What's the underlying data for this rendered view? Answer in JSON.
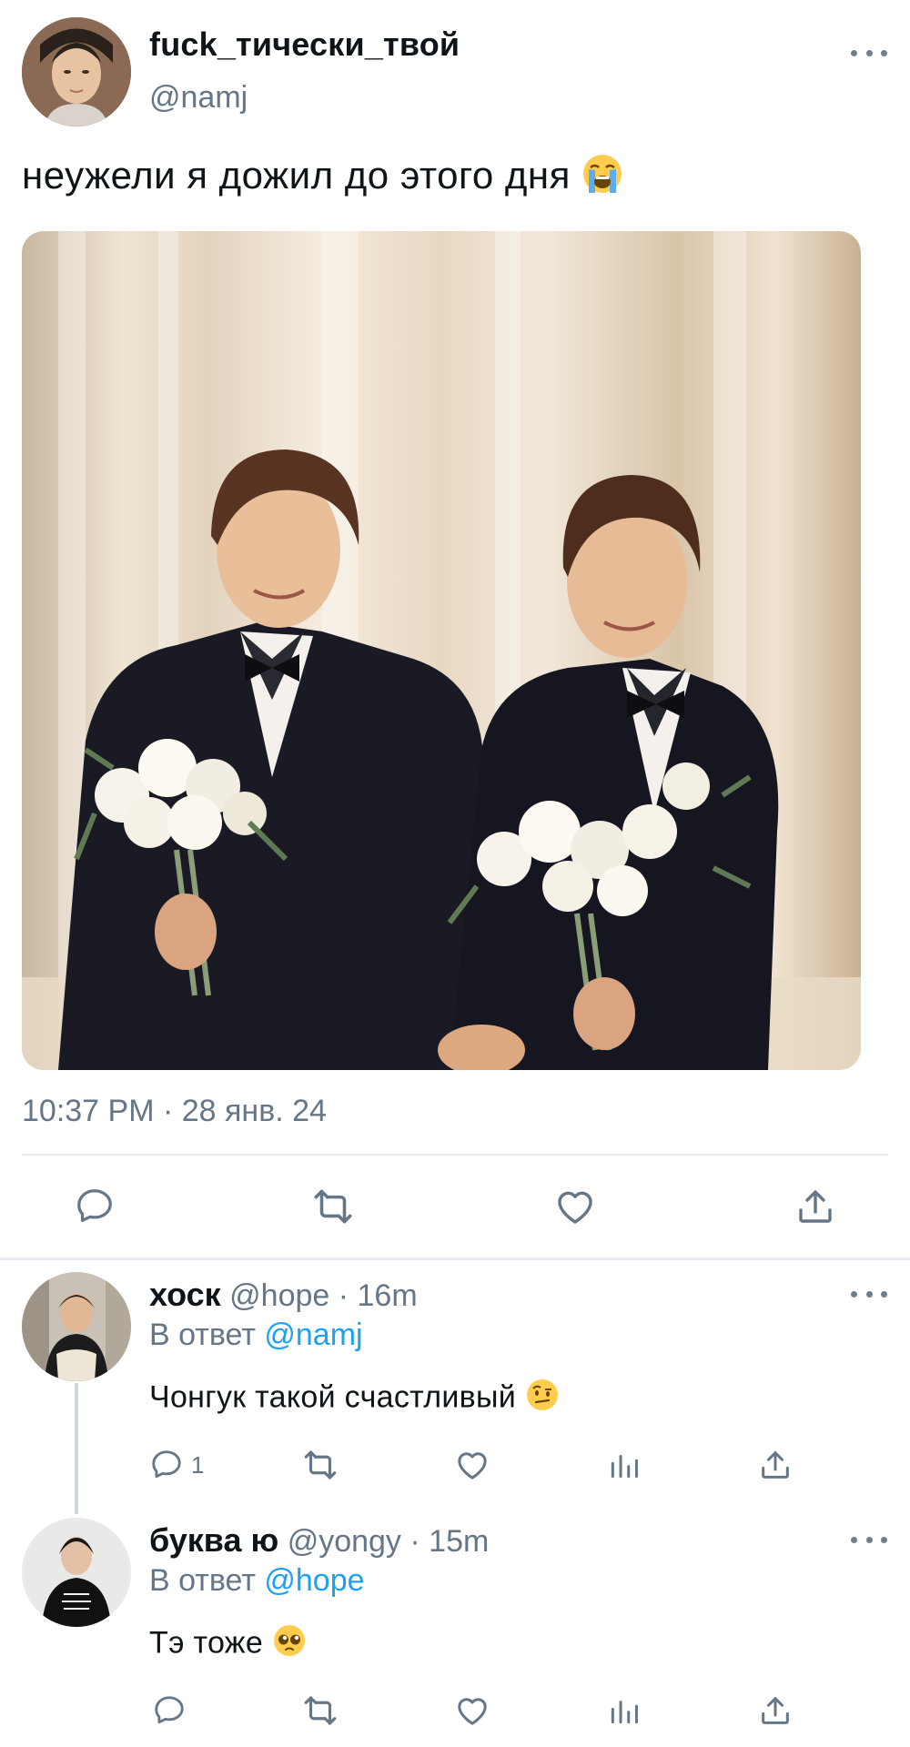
{
  "tweet": {
    "display_name": "fuck_тически_твой",
    "handle": "@namj",
    "text": "неужели я дожил до этого дня",
    "text_emoji": "loudly-crying-face",
    "timestamp": "10:37 PM · 28 янв. 24",
    "media_description_icon": "photo",
    "actions": {
      "reply_icon": "reply-icon",
      "retweet_icon": "retweet-icon",
      "like_icon": "heart-icon",
      "share_icon": "share-icon"
    }
  },
  "replies": [
    {
      "name": "хоск",
      "handle": "@hope",
      "time": "· 16m",
      "reply_to_label": "В ответ",
      "reply_to_mention": "@namj",
      "text": "Чонгук такой счастливый",
      "text_emoji": "face-with-raised-eyebrow",
      "reply_count": "1"
    },
    {
      "name": "буква ю",
      "handle": "@yongy",
      "time": "· 15m",
      "reply_to_label": "В ответ",
      "reply_to_mention": "@hope",
      "text": "Тэ тоже",
      "text_emoji": "pleading-face",
      "reply_count": ""
    }
  ],
  "colors": {
    "text": "#0f1419",
    "secondary": "#657786",
    "link": "#1da1f2",
    "divider": "#e6ecf0",
    "icon": "#657786"
  }
}
